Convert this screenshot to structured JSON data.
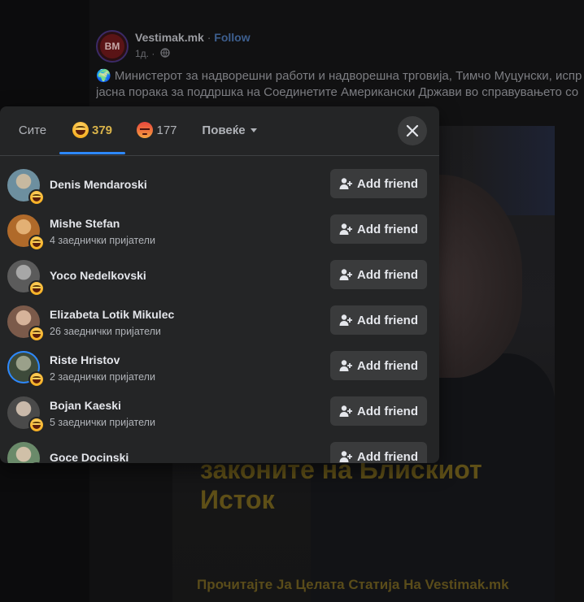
{
  "post": {
    "page_initials": "BM",
    "page_name": "Vestimak.mk",
    "dot": "·",
    "follow_label": "Follow",
    "time": "1д. ·",
    "text_line1": "🌍 Министерот за надворешни работи и надворешна трговија, Тимчо Муцунски, испр",
    "text_line2": "јасна порака за поддршка на Соединетите Американски Држави во справувањето со",
    "image_headline_line1": "законите на Блискиот",
    "image_headline_line2": "Исток",
    "image_footer": "Прочитајте Ја Целата Статија На Vestimak.mk"
  },
  "modal": {
    "tabs": {
      "all": "Сите",
      "haha_count": "379",
      "angry_count": "177",
      "more": "Повеќе"
    },
    "add_friend_label": "Add friend",
    "people": [
      {
        "name": "Denis Mendaroski",
        "mutual": "",
        "colors": [
          "#6d8f9f",
          "#c7b9a0"
        ]
      },
      {
        "name": "Mishe Stefan",
        "mutual": "4 заеднички пријатели",
        "colors": [
          "#b06a2a",
          "#e3b074"
        ]
      },
      {
        "name": "Yoco Nedelkovski",
        "mutual": "",
        "colors": [
          "#5b5b5b",
          "#a7a7a7"
        ]
      },
      {
        "name": "Elizabeta Lotik Mikulec",
        "mutual": "26 заеднички пријатели",
        "colors": [
          "#7b5a4a",
          "#d6b39a"
        ]
      },
      {
        "name": "Riste Hristov",
        "mutual": "2 заеднички пријатели",
        "colors": [
          "#3d4a3a",
          "#9aa08a"
        ]
      },
      {
        "name": "Bojan Kaeski",
        "mutual": "5 заеднички пријатели",
        "colors": [
          "#4a4a4a",
          "#c9b9aa"
        ]
      },
      {
        "name": "Goce Docinski",
        "mutual": "",
        "colors": [
          "#6a8a6a",
          "#d0c0a8"
        ]
      }
    ]
  }
}
